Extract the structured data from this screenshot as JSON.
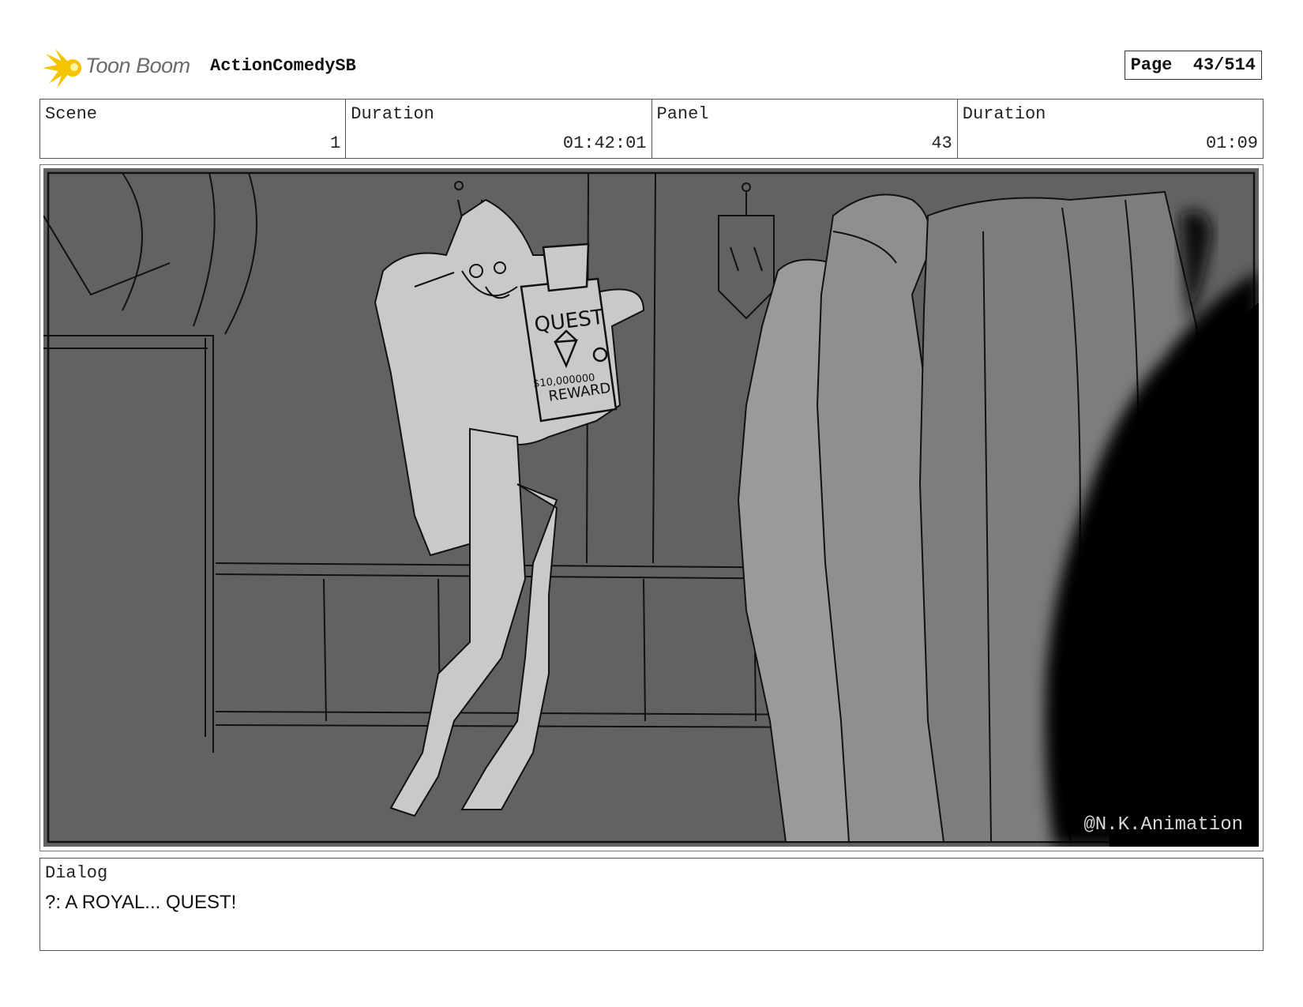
{
  "header": {
    "logo_text": "Toon Boom",
    "project_title": "ActionComedySB",
    "page_label": "Page",
    "page_value": "43/514"
  },
  "info": {
    "scene_label": "Scene",
    "scene_value": "1",
    "scene_duration_label": "Duration",
    "scene_duration_value": "01:42:01",
    "panel_label": "Panel",
    "panel_value": "43",
    "panel_duration_label": "Duration",
    "panel_duration_value": "01:09"
  },
  "panel": {
    "watermark": "@N.K.Animation",
    "sign_title": "QUEST",
    "sign_amount": "$10,000000",
    "sign_reward": "REWARD"
  },
  "dialog": {
    "label": "Dialog",
    "text": "?: A ROYAL... QUEST!"
  },
  "colors": {
    "logo_accent": "#f5c400",
    "background_wall": "#606060",
    "foreground_shadow": "#000000"
  }
}
